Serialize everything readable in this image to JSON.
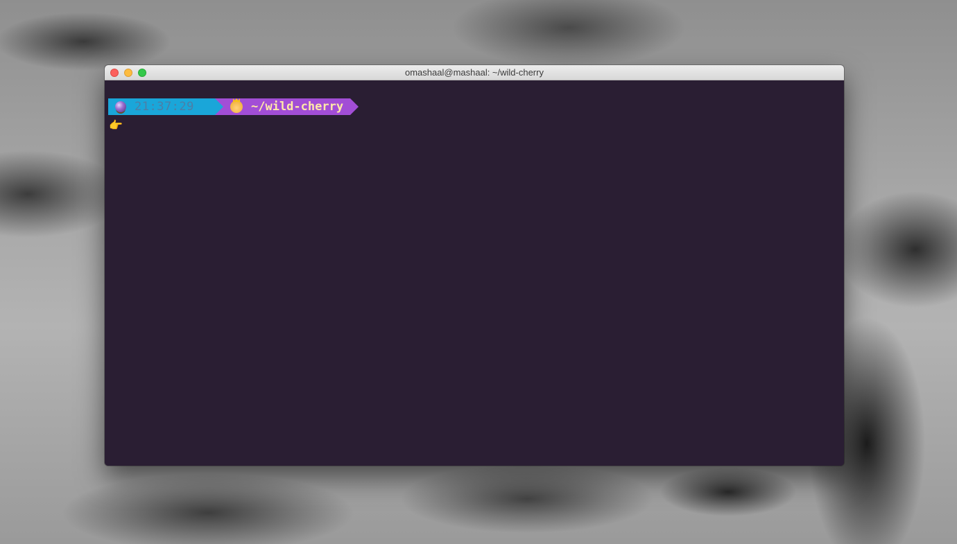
{
  "window": {
    "title": "omashaal@mashaal: ~/wild-cherry"
  },
  "prompt": {
    "time": "21:37:29",
    "directory": "~/wild-cherry",
    "time_icon": "crystal-ball",
    "dir_icon": "princess",
    "input_icon": "pointing-hand"
  },
  "colors": {
    "terminal_bg": "#2a1e33",
    "time_segment": "#1aa6d9",
    "dir_segment": "#a24ed6",
    "dir_text": "#ffe8a8"
  }
}
